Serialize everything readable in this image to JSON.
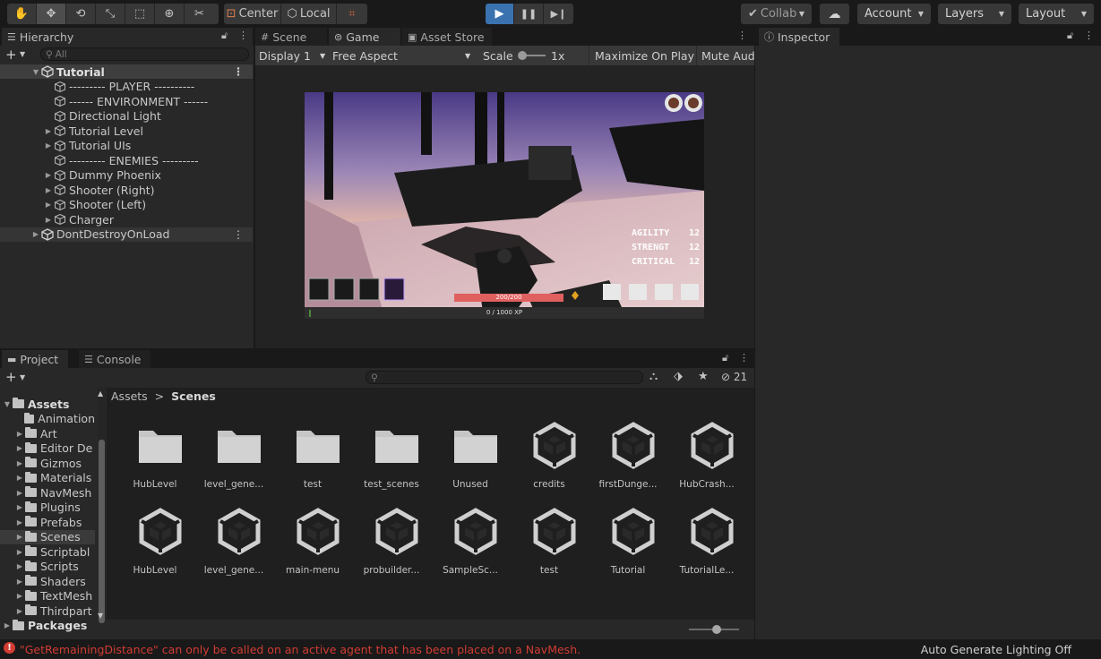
{
  "toolbar": {
    "tools": [
      {
        "name": "hand-tool-icon",
        "glyph": "✋"
      },
      {
        "name": "move-tool-icon",
        "glyph": "✥"
      },
      {
        "name": "rotate-tool-icon",
        "glyph": "⟲"
      },
      {
        "name": "scale-tool-icon",
        "glyph": "⤡"
      },
      {
        "name": "rect-tool-icon",
        "glyph": "⬚"
      },
      {
        "name": "transform-tool-icon",
        "glyph": "⊕"
      },
      {
        "name": "custom-tool-icon",
        "glyph": "✂"
      }
    ],
    "pivot_center": "Center",
    "pivot_local": "Local",
    "collab": "Collab",
    "account": "Account",
    "layers": "Layers",
    "layout": "Layout",
    "accent_color": "#3a72b0"
  },
  "hierarchy": {
    "tab_label": "Hierarchy",
    "search_placeholder": "All",
    "items": [
      {
        "label": "Tutorial",
        "type": "scene",
        "expanded": true
      },
      {
        "label": "--------- PLAYER ----------",
        "type": "object"
      },
      {
        "label": "------ ENVIRONMENT ------",
        "type": "object"
      },
      {
        "label": "Directional Light",
        "type": "object"
      },
      {
        "label": "Tutorial Level",
        "type": "object",
        "has_children": true
      },
      {
        "label": "Tutorial UIs",
        "type": "object",
        "has_children": true
      },
      {
        "label": "--------- ENEMIES ---------",
        "type": "object"
      },
      {
        "label": "Dummy Phoenix",
        "type": "object",
        "has_children": true
      },
      {
        "label": "Shooter (Right)",
        "type": "object",
        "has_children": true
      },
      {
        "label": "Shooter (Left)",
        "type": "object",
        "has_children": true
      },
      {
        "label": "Charger",
        "type": "object",
        "has_children": true
      },
      {
        "label": "DontDestroyOnLoad",
        "type": "scene",
        "expanded": false
      }
    ]
  },
  "center_tabs": {
    "scene": "Scene",
    "game": "Game",
    "asset_store": "Asset Store"
  },
  "game_bar": {
    "display": "Display 1",
    "aspect": "Free Aspect",
    "scale_label": "Scale",
    "scale_value": "1x",
    "maximize": "Maximize On Play",
    "mute": "Mute Audi"
  },
  "game_hud": {
    "stats": [
      {
        "label": "AGILITY",
        "value": "12"
      },
      {
        "label": "STRENGT",
        "value": "12"
      },
      {
        "label": "CRITICAL",
        "value": "12"
      }
    ],
    "health_text": "200/200",
    "health_fraction": 1.0,
    "xp_text": "0 / 1000 XP",
    "xp_fraction": 0.0
  },
  "inspector": {
    "tab_label": "Inspector"
  },
  "project": {
    "tab_project": "Project",
    "tab_console": "Console",
    "hidden_count": "21",
    "tree": [
      {
        "label": "Assets",
        "level": 0,
        "bold": true,
        "expanded": true
      },
      {
        "label": "Animation",
        "level": 1,
        "has_children": false
      },
      {
        "label": "Art",
        "level": 1,
        "has_children": true
      },
      {
        "label": "Editor De",
        "level": 1,
        "has_children": true
      },
      {
        "label": "Gizmos",
        "level": 1,
        "has_children": true
      },
      {
        "label": "Materials",
        "level": 1,
        "has_children": true
      },
      {
        "label": "NavMesh",
        "level": 1,
        "has_children": true
      },
      {
        "label": "Plugins",
        "level": 1,
        "has_children": true
      },
      {
        "label": "Prefabs",
        "level": 1,
        "has_children": true
      },
      {
        "label": "Scenes",
        "level": 1,
        "has_children": true,
        "selected": true
      },
      {
        "label": "Scriptabl",
        "level": 1,
        "has_children": true
      },
      {
        "label": "Scripts",
        "level": 1,
        "has_children": true
      },
      {
        "label": "Shaders",
        "level": 1,
        "has_children": true
      },
      {
        "label": "TextMesh",
        "level": 1,
        "has_children": true
      },
      {
        "label": "Thirdpart",
        "level": 1,
        "has_children": true
      },
      {
        "label": "Packages",
        "level": 0,
        "bold": true,
        "expanded": false
      }
    ],
    "breadcrumb": {
      "root": "Assets",
      "separator": ">",
      "current": "Scenes"
    },
    "assets": [
      {
        "label": "HubLevel",
        "kind": "folder"
      },
      {
        "label": "level_gene...",
        "kind": "folder"
      },
      {
        "label": "test",
        "kind": "folder"
      },
      {
        "label": "test_scenes",
        "kind": "folder"
      },
      {
        "label": "Unused",
        "kind": "folder"
      },
      {
        "label": "credits",
        "kind": "scene"
      },
      {
        "label": "firstDunge...",
        "kind": "scene"
      },
      {
        "label": "HubCrash...",
        "kind": "scene"
      },
      {
        "label": "HubLevel",
        "kind": "scene"
      },
      {
        "label": "level_gene...",
        "kind": "scene"
      },
      {
        "label": "main-menu",
        "kind": "scene"
      },
      {
        "label": "probuilder...",
        "kind": "scene"
      },
      {
        "label": "SampleSc...",
        "kind": "scene"
      },
      {
        "label": "test",
        "kind": "scene"
      },
      {
        "label": "Tutorial",
        "kind": "scene"
      },
      {
        "label": "TutorialLe...",
        "kind": "scene"
      }
    ]
  },
  "status": {
    "error": "\"GetRemainingDistance\" can only be called on an active agent that has been placed on a NavMesh.",
    "lighting": "Auto Generate Lighting Off",
    "error_color": "#d13c33"
  }
}
